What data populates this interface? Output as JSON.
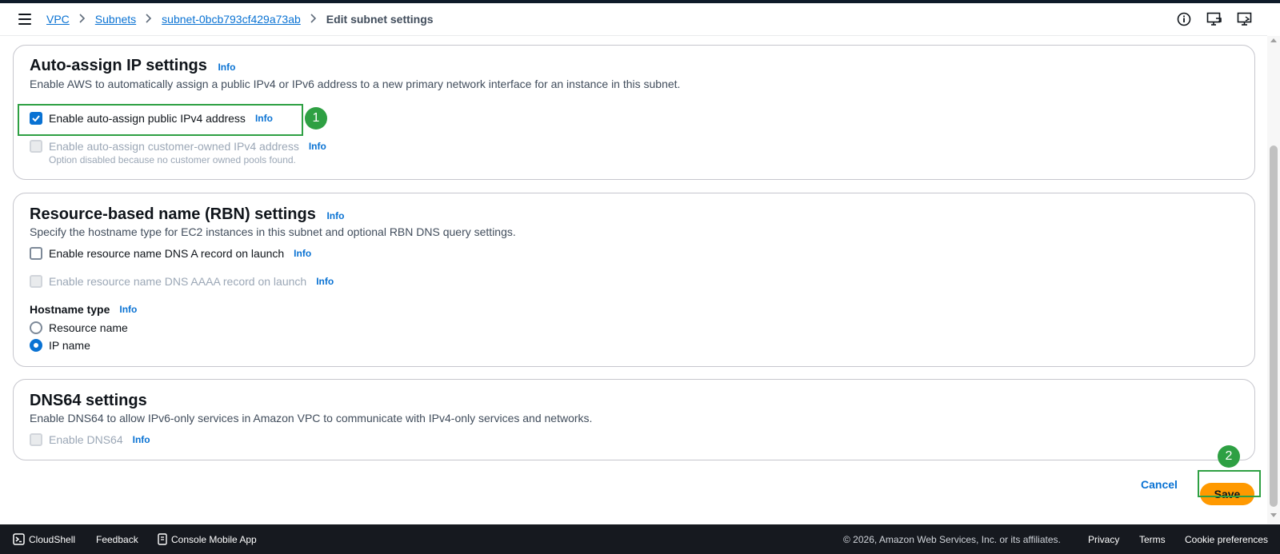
{
  "breadcrumb": {
    "items": [
      "VPC",
      "Subnets",
      "subnet-0bcb793cf429a73ab"
    ],
    "current": "Edit subnet settings",
    "separator": ">"
  },
  "header_icons": [
    "info-icon",
    "notifications-icon",
    "display-icon"
  ],
  "auto_assign": {
    "title": "Auto-assign IP settings",
    "info": "Info",
    "description": "Enable AWS to automatically assign a public IPv4 or IPv6 address to a new primary network interface for an instance in this subnet.",
    "public_ipv4_label": "Enable auto-assign public IPv4 address",
    "public_ipv4_checked": true,
    "customer_owned_label": "Enable auto-assign customer-owned IPv4 address",
    "customer_owned_note": "Option disabled because no customer owned pools found."
  },
  "rbn": {
    "title": "Resource-based name (RBN) settings",
    "info": "Info",
    "description": "Specify the hostname type for EC2 instances in this subnet and optional RBN DNS query settings.",
    "dns_a_label": "Enable resource name DNS A record on launch",
    "dns_a_checked": false,
    "dns_aaaa_label": "Enable resource name DNS AAAA record on launch",
    "hostname_type_label": "Hostname type",
    "hostname_options": [
      "Resource name",
      "IP name"
    ],
    "hostname_selected": "IP name"
  },
  "dns64": {
    "title": "DNS64 settings",
    "description": "Enable DNS64 to allow IPv6-only services in Amazon VPC to communicate with IPv4-only services and networks.",
    "enable_label": "Enable DNS64",
    "info": "Info"
  },
  "actions": {
    "cancel": "Cancel",
    "save": "Save"
  },
  "annotations": {
    "step1": "1",
    "step2": "2",
    "highlight_color": "#2ea043"
  },
  "footer": {
    "cloudshell": "CloudShell",
    "feedback": "Feedback",
    "mobile_app": "Console Mobile App",
    "copyright": "© 2026, Amazon Web Services, Inc. or its affiliates.",
    "privacy": "Privacy",
    "terms": "Terms",
    "cookies": "Cookie preferences"
  },
  "colors": {
    "accent": "#0972d3",
    "save_button": "#ff9900",
    "footer_bg": "#16191f"
  }
}
